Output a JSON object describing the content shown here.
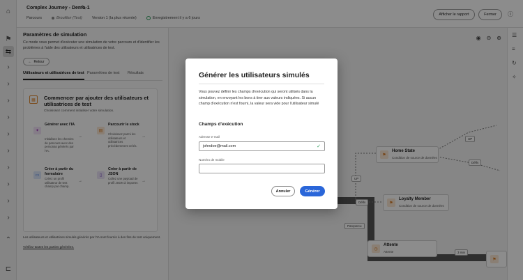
{
  "header": {
    "title": "Complex Journey - Demo-1",
    "breadcrumb": "Parcours",
    "status": "Brouillon (Test)",
    "version": "Version 1 (la plus récente)",
    "saved": "Enregistrement il y a 6 jours",
    "report_button": "Afficher le rapport",
    "close_button": "Fermer"
  },
  "panel": {
    "title": "Paramètres de simulation",
    "description": "Ce mode vous permet d'exécuter une simulation de votre parcours et d'identifier les problèmes à l'aide des utilisateurs et utilisatrices de test.",
    "back_label": "Retour",
    "tabs": [
      {
        "label": "Utilisateurs et utilisatrices de test"
      },
      {
        "label": "Paramètres de test"
      },
      {
        "label": "Résultats"
      }
    ],
    "card": {
      "title": "Commencer par ajouter des utilisateurs et utilisatrices de test",
      "subtitle": "Choisissez comment initialiser votre simulation.",
      "options": [
        {
          "title": "Générer avec l'IA",
          "desc": "Initialisez les chemins de parcours avec des personas générés par l'IA."
        },
        {
          "title": "Parcourir le stock",
          "desc": "Choisissez parmi les utilisateurs et utilisatrices précédemment créés."
        },
        {
          "title": "Créer à partir du formulaire",
          "desc": "Créez un profil utilisateur de test champ par champ."
        },
        {
          "title": "Créer à partir de JSON",
          "desc": "Collez une payload de profil JSON à importer."
        }
      ]
    },
    "footnote": "Les utilisateurs et utilisatrices simulés générés par l'IA sont fournis à des fins de test uniquement.",
    "footlink": "Vérifiez toutes les parties générées."
  },
  "canvas": {
    "nodes": [
      {
        "title": "Home State",
        "subtitle": "Condition de source de données"
      },
      {
        "title": "Loyalty Member",
        "subtitle": "Condition de source de données"
      },
      {
        "title": "Attente",
        "subtitle": "Attente"
      }
    ],
    "edge_labels": [
      "UP",
      "Défls",
      "UP",
      "Défls",
      "Parcpercu",
      "3 min"
    ]
  },
  "modal": {
    "title": "Générer les utilisateurs simulés",
    "description": "Vous pouvez définir les champs d'exécution qui seront utilisés dans la simulation, en envoyant les bons à tirer aux valeurs indiquées. Si aucun champ d'exécution n'est fourni, la valeur sera vide pour l'utilisateur simulé",
    "section": "Champs d'exécution",
    "email_label": "Adresse e-mail",
    "email_value": "johndoe@mail.com",
    "phone_label": "Numéro de mobile",
    "phone_value": "",
    "cancel_label": "Annuler",
    "generate_label": "Générer"
  },
  "colors": {
    "accent": "#2a66d9",
    "valid": "#2d9d5c",
    "node_icon": "#d4761c"
  }
}
